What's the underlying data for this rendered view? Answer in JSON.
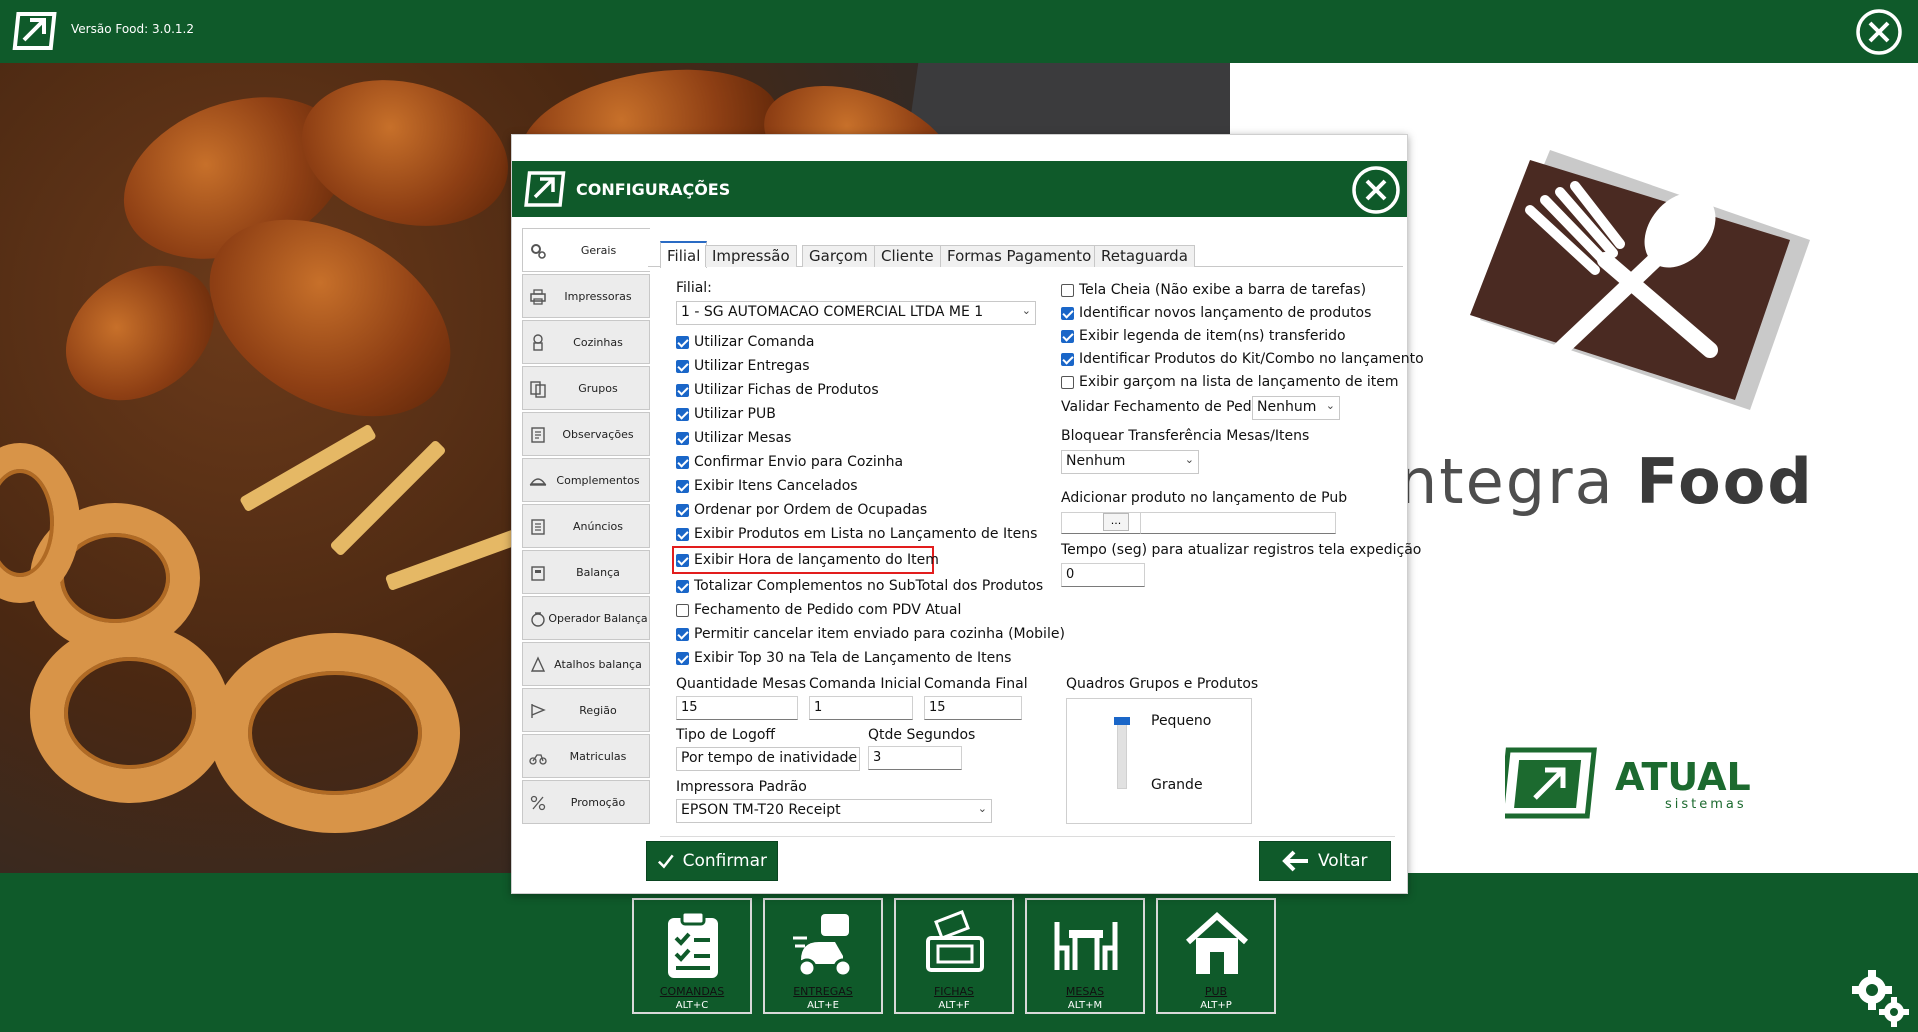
{
  "app": {
    "version": "Versão Food: 3.0.1.2",
    "brand_light": "ntegra ",
    "brand_bold": "Food",
    "atual_name": "ATUAL",
    "atual_sub": "sistemas"
  },
  "bottom_nav": [
    {
      "label": "COMANDAS",
      "key": "ALT+C",
      "icon": "clipboard-icon"
    },
    {
      "label": "ENTREGAS",
      "key": "ALT+E",
      "icon": "scooter-icon"
    },
    {
      "label": "FICHAS",
      "key": "ALT+F",
      "icon": "ticket-icon"
    },
    {
      "label": "MESAS",
      "key": "ALT+M",
      "icon": "table-icon"
    },
    {
      "label": "PUB",
      "key": "ALT+P",
      "icon": "house-icon"
    }
  ],
  "dialog": {
    "title": "CONFIGURAÇÕES",
    "side_items": [
      "Gerais",
      "Impressoras",
      "Cozinhas",
      "Grupos",
      "Observações",
      "Complementos",
      "Anúncios",
      "Balança",
      "Operador Balança",
      "Atalhos balança",
      "Região",
      "Matriculas",
      "Promoção"
    ],
    "active_side": "Gerais",
    "tabs": [
      "Filial",
      "Impressão",
      "Garçom",
      "Cliente",
      "Formas Pagamento",
      "Retaguarda"
    ],
    "active_tab": "Filial",
    "left": {
      "filial_label": "Filial:",
      "filial_value": "1 - SG AUTOMACAO COMERCIAL LTDA ME 1",
      "checkboxes": [
        {
          "label": "Utilizar Comanda",
          "checked": true
        },
        {
          "label": "Utilizar Entregas",
          "checked": true
        },
        {
          "label": "Utilizar Fichas de Produtos",
          "checked": true
        },
        {
          "label": "Utilizar PUB",
          "checked": true
        },
        {
          "label": "Utilizar Mesas",
          "checked": true
        },
        {
          "label": "Confirmar Envio para Cozinha",
          "checked": true
        },
        {
          "label": "Exibir Itens Cancelados",
          "checked": true
        },
        {
          "label": "Ordenar por Ordem de Ocupadas",
          "checked": true
        },
        {
          "label": "Exibir Produtos em Lista no Lançamento de Itens",
          "checked": true
        },
        {
          "label": "Exibir Hora de lançamento do Item",
          "checked": true
        },
        {
          "label": "Totalizar Complementos no SubTotal dos Produtos",
          "checked": true
        },
        {
          "label": "Fechamento de Pedido com PDV Atual",
          "checked": false
        },
        {
          "label": "Permitir cancelar item enviado para cozinha (Mobile)",
          "checked": true
        },
        {
          "label": "Exibir Top 30 na Tela de Lançamento de Itens",
          "checked": true
        }
      ],
      "qtd_mesas_label": "Quantidade Mesas",
      "qtd_mesas_value": "15",
      "comanda_inicial_label": "Comanda Inicial",
      "comanda_inicial_value": "1",
      "comanda_final_label": "Comanda Final",
      "comanda_final_value": "15",
      "tipo_logoff_label": "Tipo de Logoff",
      "tipo_logoff_value": "Por tempo de inatividade",
      "qtde_segundos_label": "Qtde Segundos",
      "qtde_segundos_value": "3",
      "impressora_label": "Impressora Padrão",
      "impressora_value": "EPSON TM-T20 Receipt"
    },
    "right": {
      "checkboxes": [
        {
          "label": "Tela Cheia (Não exibe a barra de tarefas)",
          "checked": false
        },
        {
          "label": "Identificar novos lançamento de produtos",
          "checked": true
        },
        {
          "label": "Exibir legenda de item(ns) transferido",
          "checked": true
        },
        {
          "label": "Identificar Produtos do Kit/Combo no lançamento",
          "checked": true
        },
        {
          "label": "Exibir garçom na lista de lançamento de item",
          "checked": false
        }
      ],
      "validar_label": "Validar Fechamento de Pedido",
      "validar_value": "Nenhum",
      "bloquear_label": "Bloquear Transferência Mesas/Itens",
      "bloquear_value": "Nenhum",
      "adicionar_label": "Adicionar produto no lançamento de Pub",
      "adicionar_button": "...",
      "tempo_label": "Tempo (seg) para atualizar registros tela expedição",
      "tempo_value": "0",
      "quadros_label": "Quadros Grupos e Produtos",
      "quadros_options": [
        "Pequeno",
        "Grande"
      ],
      "quadros_selected": "Pequeno"
    },
    "confirm_label": "Confirmar",
    "back_label": "Voltar"
  },
  "colors": {
    "brand_green": "#0f5a2a",
    "checkbox_blue": "#1a66c8",
    "highlight_red": "#e21d1d"
  }
}
